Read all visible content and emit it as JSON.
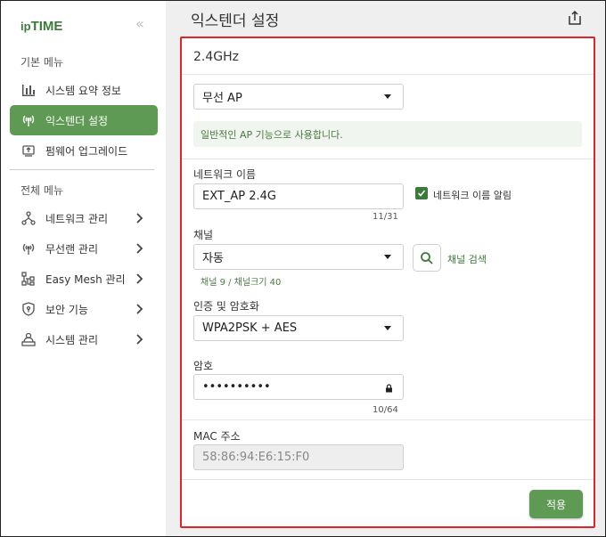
{
  "sidebar": {
    "logo_prefix": "ip",
    "logo_main": "TIME",
    "basic_menu_head": "기본 메뉴",
    "basic_items": [
      {
        "label": "시스템 요약 정보",
        "icon": "bar-chart-icon"
      },
      {
        "label": "익스텐더 설정",
        "icon": "wireless-antenna-icon",
        "active": true
      },
      {
        "label": "펌웨어 업그레이드",
        "icon": "firmware-chip-icon"
      }
    ],
    "all_menu_head": "전체 메뉴",
    "all_items": [
      {
        "label": "네트워크 관리",
        "icon": "network-nodes-icon"
      },
      {
        "label": "무선랜 관리",
        "icon": "wireless-antenna-icon"
      },
      {
        "label": "Easy Mesh 관리",
        "icon": "mesh-tree-icon"
      },
      {
        "label": "보안 기능",
        "icon": "shield-icon"
      },
      {
        "label": "시스템 관리",
        "icon": "user-system-icon"
      }
    ]
  },
  "main": {
    "title": "익스텐더 설정",
    "section_title": "2.4GHz",
    "mode_select": "무선 AP",
    "mode_info": "일반적인 AP 기능으로 사용합니다.",
    "network_name_label": "네트워크 이름",
    "network_name_value": "EXT_AP 2.4G",
    "network_name_counter": "11/31",
    "broadcast_label": "네트워크 이름 알림",
    "broadcast_checked": true,
    "channel_label": "채널",
    "channel_value": "자동",
    "channel_search": "채널 검색",
    "channel_hint": "채널 9 / 채널크기 40",
    "auth_label": "인증 및 암호화",
    "auth_value": "WPA2PSK + AES",
    "password_label": "암호",
    "password_value": "••••••••••",
    "password_counter": "10/64",
    "mac_label": "MAC 주소",
    "mac_value": "58:86:94:E6:15:F0",
    "apply_label": "적용"
  },
  "colors": {
    "accent_green": "#5e9a53",
    "highlight_red": "#e0242c"
  }
}
